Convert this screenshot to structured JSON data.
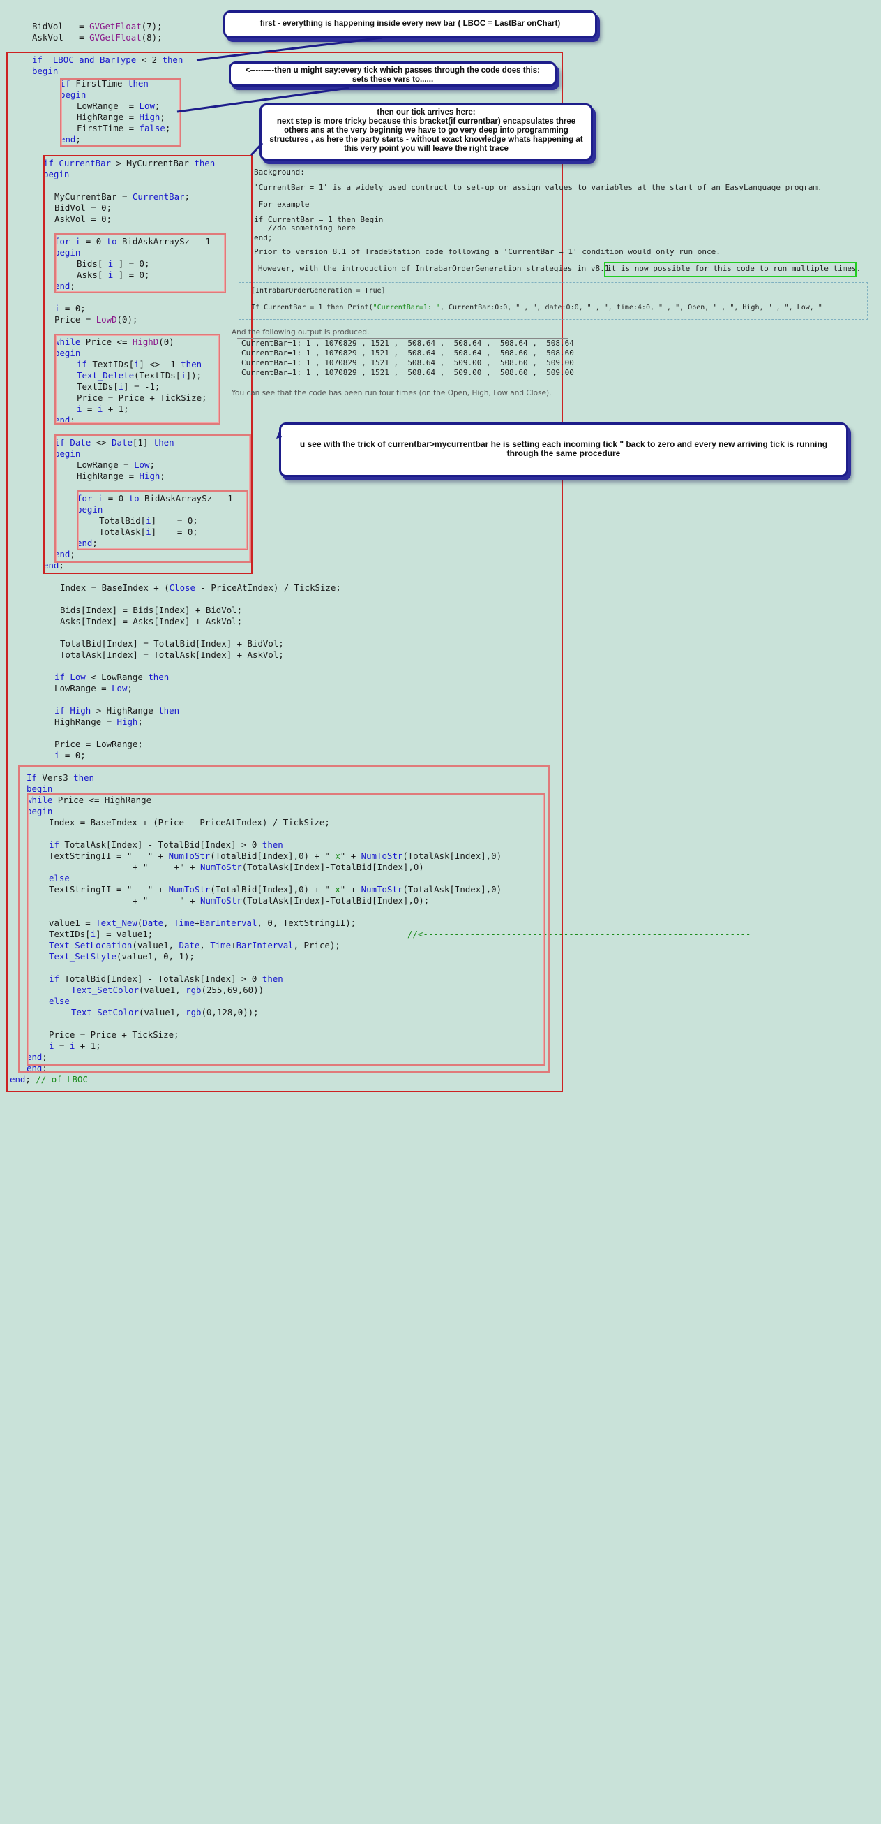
{
  "code_lines": [
    {
      "id": "l1",
      "parts": [
        [
          "",
          "BidVol   = "
        ],
        [
          "pu",
          "GVGetFloat"
        ],
        [
          "",
          "(7);"
        ]
      ]
    },
    {
      "id": "l2",
      "parts": [
        [
          "",
          "AskVol   = "
        ],
        [
          "pu",
          "GVGetFloat"
        ],
        [
          "",
          "(8);"
        ]
      ]
    },
    {
      "id": "l3",
      "parts": [
        [
          "kw",
          "if  LBOC and BarType"
        ],
        [
          "",
          " < 2 "
        ],
        [
          "kw",
          "then"
        ]
      ]
    },
    {
      "id": "l4",
      "parts": [
        [
          "kw",
          "begin"
        ]
      ]
    },
    {
      "id": "l5",
      "parts": [
        [
          "kw",
          "if"
        ],
        [
          "",
          " FirstTime "
        ],
        [
          "kw",
          "then"
        ]
      ]
    },
    {
      "id": "l6",
      "parts": [
        [
          "kw",
          "begin"
        ]
      ]
    },
    {
      "id": "l7",
      "parts": [
        [
          "",
          "LowRange  = "
        ],
        [
          "kw",
          "Low"
        ],
        [
          "",
          ";"
        ]
      ]
    },
    {
      "id": "l8",
      "parts": [
        [
          "",
          "HighRange = "
        ],
        [
          "kw",
          "High"
        ],
        [
          "",
          ";"
        ]
      ]
    },
    {
      "id": "l9",
      "parts": [
        [
          "",
          "FirstTime = "
        ],
        [
          "kw",
          "false"
        ],
        [
          "",
          ";"
        ]
      ]
    },
    {
      "id": "l10",
      "parts": [
        [
          "kw",
          "end"
        ],
        [
          "",
          ";"
        ]
      ]
    },
    {
      "id": "l11",
      "parts": [
        [
          "kw",
          "if"
        ],
        [
          "",
          " "
        ],
        [
          "kw",
          "CurrentBar"
        ],
        [
          "",
          " > MyCurrentBar "
        ],
        [
          "kw",
          "then"
        ]
      ]
    },
    {
      "id": "l12",
      "parts": [
        [
          "kw",
          "begin"
        ]
      ]
    },
    {
      "id": "l13",
      "parts": [
        [
          "",
          "MyCurrentBar = "
        ],
        [
          "kw",
          "CurrentBar"
        ],
        [
          "",
          ";"
        ]
      ]
    },
    {
      "id": "l14",
      "parts": [
        [
          "",
          "BidVol = 0;"
        ]
      ]
    },
    {
      "id": "l15",
      "parts": [
        [
          "",
          "AskVol = 0;"
        ]
      ]
    },
    {
      "id": "l16",
      "parts": [
        [
          "kw",
          "for"
        ],
        [
          "",
          " "
        ],
        [
          "kw",
          "i"
        ],
        [
          "",
          " = 0 "
        ],
        [
          "kw",
          "to"
        ],
        [
          "",
          " BidAskArraySz - 1"
        ]
      ]
    },
    {
      "id": "l17",
      "parts": [
        [
          "kw",
          "begin"
        ]
      ]
    },
    {
      "id": "l18",
      "parts": [
        [
          "",
          "Bids[ "
        ],
        [
          "kw",
          "i"
        ],
        [
          "",
          " ] = 0;"
        ]
      ]
    },
    {
      "id": "l19",
      "parts": [
        [
          "",
          "Asks[ "
        ],
        [
          "kw",
          "i"
        ],
        [
          "",
          " ] = 0;"
        ]
      ]
    },
    {
      "id": "l20",
      "parts": [
        [
          "kw",
          "end"
        ],
        [
          "",
          ";"
        ]
      ]
    },
    {
      "id": "l21",
      "parts": [
        [
          "kw",
          "i"
        ],
        [
          "",
          " = 0;"
        ]
      ]
    },
    {
      "id": "l22",
      "parts": [
        [
          "",
          "Price = "
        ],
        [
          "pu",
          "LowD"
        ],
        [
          "",
          "(0);"
        ]
      ]
    },
    {
      "id": "l23",
      "parts": [
        [
          "kw",
          "while"
        ],
        [
          "",
          " Price <= "
        ],
        [
          "pu",
          "HighD"
        ],
        [
          "",
          "(0)"
        ]
      ]
    },
    {
      "id": "l24",
      "parts": [
        [
          "kw",
          "begin"
        ]
      ]
    },
    {
      "id": "l25",
      "parts": [
        [
          "kw",
          "if"
        ],
        [
          "",
          " TextIDs["
        ],
        [
          "kw",
          "i"
        ],
        [
          "",
          "] <> -1 "
        ],
        [
          "kw",
          "then"
        ]
      ]
    },
    {
      "id": "l26",
      "parts": [
        [
          "fn",
          "Text_Delete"
        ],
        [
          "",
          "(TextIDs["
        ],
        [
          "kw",
          "i"
        ],
        [
          "",
          "]);"
        ]
      ]
    },
    {
      "id": "l27",
      "parts": [
        [
          "",
          "TextIDs["
        ],
        [
          "kw",
          "i"
        ],
        [
          "",
          "] = -1;"
        ]
      ]
    },
    {
      "id": "l28",
      "parts": [
        [
          "",
          "Price = Price + TickSize;"
        ]
      ]
    },
    {
      "id": "l29",
      "parts": [
        [
          "kw",
          "i"
        ],
        [
          "",
          " = "
        ],
        [
          "kw",
          "i"
        ],
        [
          "",
          " + 1;"
        ]
      ]
    },
    {
      "id": "l30",
      "parts": [
        [
          "kw",
          "end"
        ],
        [
          "",
          ";"
        ]
      ]
    },
    {
      "id": "l31",
      "parts": [
        [
          "kw",
          "if"
        ],
        [
          "",
          " "
        ],
        [
          "kw",
          "Date"
        ],
        [
          "",
          " <> "
        ],
        [
          "kw",
          "Date"
        ],
        [
          "",
          "[1] "
        ],
        [
          "kw",
          "then"
        ]
      ]
    },
    {
      "id": "l32",
      "parts": [
        [
          "kw",
          "begin"
        ]
      ]
    },
    {
      "id": "l33",
      "parts": [
        [
          "",
          "LowRange = "
        ],
        [
          "kw",
          "Low"
        ],
        [
          "",
          ";"
        ]
      ]
    },
    {
      "id": "l34",
      "parts": [
        [
          "",
          "HighRange = "
        ],
        [
          "kw",
          "High"
        ],
        [
          "",
          ";"
        ]
      ]
    },
    {
      "id": "l35",
      "parts": [
        [
          "kw",
          "for"
        ],
        [
          "",
          " "
        ],
        [
          "kw",
          "i"
        ],
        [
          "",
          " = 0 "
        ],
        [
          "kw",
          "to"
        ],
        [
          "",
          " BidAskArraySz - 1"
        ]
      ]
    },
    {
      "id": "l36",
      "parts": [
        [
          "kw",
          "begin"
        ]
      ]
    },
    {
      "id": "l37",
      "parts": [
        [
          "",
          "TotalBid["
        ],
        [
          "kw",
          "i"
        ],
        [
          "",
          "]    = 0;"
        ]
      ]
    },
    {
      "id": "l38",
      "parts": [
        [
          "",
          "TotalAsk["
        ],
        [
          "kw",
          "i"
        ],
        [
          "",
          "]    = 0;"
        ]
      ]
    },
    {
      "id": "l39",
      "parts": [
        [
          "kw",
          "end"
        ],
        [
          "",
          ";"
        ]
      ]
    },
    {
      "id": "l40",
      "parts": [
        [
          "kw",
          "end"
        ],
        [
          "",
          ";"
        ]
      ]
    },
    {
      "id": "l41",
      "parts": [
        [
          "kw",
          "end"
        ],
        [
          "",
          ";"
        ]
      ]
    },
    {
      "id": "l42",
      "parts": [
        [
          "",
          "Index = BaseIndex + ("
        ],
        [
          "kw",
          "Close"
        ],
        [
          "",
          " - PriceAtIndex) / TickSize;"
        ]
      ]
    },
    {
      "id": "l43",
      "parts": [
        [
          "",
          "Bids[Index] = Bids[Index] + BidVol;"
        ]
      ]
    },
    {
      "id": "l44",
      "parts": [
        [
          "",
          "Asks[Index] = Asks[Index] + AskVol;"
        ]
      ]
    },
    {
      "id": "l45",
      "parts": [
        [
          "",
          "TotalBid[Index] = TotalBid[Index] + BidVol;"
        ]
      ]
    },
    {
      "id": "l46",
      "parts": [
        [
          "",
          "TotalAsk[Index] = TotalAsk[Index] + AskVol;"
        ]
      ]
    },
    {
      "id": "l47",
      "parts": [
        [
          "kw",
          "if"
        ],
        [
          "",
          " "
        ],
        [
          "kw",
          "Low"
        ],
        [
          "",
          " < LowRange "
        ],
        [
          "kw",
          "then"
        ]
      ]
    },
    {
      "id": "l48",
      "parts": [
        [
          "",
          "LowRange = "
        ],
        [
          "kw",
          "Low"
        ],
        [
          "",
          ";"
        ]
      ]
    },
    {
      "id": "l49",
      "parts": [
        [
          "kw",
          "if"
        ],
        [
          "",
          " "
        ],
        [
          "kw",
          "High"
        ],
        [
          "",
          " > HighRange "
        ],
        [
          "kw",
          "then"
        ]
      ]
    },
    {
      "id": "l50",
      "parts": [
        [
          "",
          "HighRange = "
        ],
        [
          "kw",
          "High"
        ],
        [
          "",
          ";"
        ]
      ]
    },
    {
      "id": "l51",
      "parts": [
        [
          "",
          "Price = LowRange;"
        ]
      ]
    },
    {
      "id": "l52",
      "parts": [
        [
          "kw",
          "i"
        ],
        [
          "",
          " = 0;"
        ]
      ]
    },
    {
      "id": "l53",
      "parts": [
        [
          "kw",
          "If"
        ],
        [
          "",
          " Vers3 "
        ],
        [
          "kw",
          "then"
        ]
      ]
    },
    {
      "id": "l54",
      "parts": [
        [
          "kw",
          "begin"
        ]
      ]
    },
    {
      "id": "l55",
      "parts": [
        [
          "kw",
          "while"
        ],
        [
          "",
          " Price <= HighRange"
        ]
      ]
    },
    {
      "id": "l56",
      "parts": [
        [
          "kw",
          "begin"
        ]
      ]
    },
    {
      "id": "l57",
      "parts": [
        [
          "",
          "Index = BaseIndex + (Price - PriceAtIndex) / TickSize;"
        ]
      ]
    },
    {
      "id": "l58",
      "parts": [
        [
          "kw",
          "if"
        ],
        [
          "",
          " TotalAsk[Index] - TotalBid[Index] > 0 "
        ],
        [
          "kw",
          "then"
        ]
      ]
    },
    {
      "id": "l59",
      "parts": [
        [
          "",
          "TextStringII = \"   \" + "
        ],
        [
          "fn",
          "NumToStr"
        ],
        [
          "",
          "(TotalBid[Index],0) + \" "
        ],
        [
          "gr",
          "x"
        ],
        [
          "",
          "\" + "
        ],
        [
          "fn",
          "NumToStr"
        ],
        [
          "",
          "(TotalAsk[Index],0)"
        ]
      ]
    },
    {
      "id": "l60",
      "parts": [
        [
          "",
          "+ \"     +\" + "
        ],
        [
          "fn",
          "NumToStr"
        ],
        [
          "",
          "(TotalAsk[Index]-TotalBid[Index],0)"
        ]
      ]
    },
    {
      "id": "l61",
      "parts": [
        [
          "kw",
          "else"
        ]
      ]
    },
    {
      "id": "l62",
      "parts": [
        [
          "",
          "TextStringII = \"   \" + "
        ],
        [
          "fn",
          "NumToStr"
        ],
        [
          "",
          "(TotalBid[Index],0) + \" "
        ],
        [
          "gr",
          "x"
        ],
        [
          "",
          "\" + "
        ],
        [
          "fn",
          "NumToStr"
        ],
        [
          "",
          "(TotalAsk[Index],0)"
        ]
      ]
    },
    {
      "id": "l63",
      "parts": [
        [
          "",
          "+ \"      \" + "
        ],
        [
          "fn",
          "NumToStr"
        ],
        [
          "",
          "(TotalAsk[Index]-TotalBid[Index],0);"
        ]
      ]
    },
    {
      "id": "l64",
      "parts": [
        [
          "",
          "value1 = "
        ],
        [
          "fn",
          "Text_New"
        ],
        [
          "",
          "("
        ],
        [
          "kw",
          "Date"
        ],
        [
          "",
          ", "
        ],
        [
          "kw",
          "Time"
        ],
        [
          "",
          "+"
        ],
        [
          "kw",
          "BarInterval"
        ],
        [
          "",
          ", 0, TextStringII);"
        ]
      ]
    },
    {
      "id": "l65",
      "parts": [
        [
          "",
          "TextIDs["
        ],
        [
          "kw",
          "i"
        ],
        [
          "",
          "] = value1;"
        ]
      ]
    },
    {
      "id": "l65c",
      "parts": [
        [
          "gr",
          "//<---------------------------------------------------------------"
        ]
      ]
    },
    {
      "id": "l66",
      "parts": [
        [
          "fn",
          "Text_SetLocation"
        ],
        [
          "",
          "(value1, "
        ],
        [
          "kw",
          "Date"
        ],
        [
          "",
          ", "
        ],
        [
          "kw",
          "Time"
        ],
        [
          "",
          "+"
        ],
        [
          "kw",
          "BarInterval"
        ],
        [
          "",
          ", Price);"
        ]
      ]
    },
    {
      "id": "l67",
      "parts": [
        [
          "fn",
          "Text_SetStyle"
        ],
        [
          "",
          "(value1, 0, 1);"
        ]
      ]
    },
    {
      "id": "l68",
      "parts": [
        [
          "kw",
          "if"
        ],
        [
          "",
          " TotalBid[Index] - TotalAsk[Index] > 0 "
        ],
        [
          "kw",
          "then"
        ]
      ]
    },
    {
      "id": "l69",
      "parts": [
        [
          "fn",
          "Text_SetColor"
        ],
        [
          "",
          "(value1, "
        ],
        [
          "fn",
          "rgb"
        ],
        [
          "",
          "(255,69,60))"
        ]
      ]
    },
    {
      "id": "l70",
      "parts": [
        [
          "kw",
          "else"
        ]
      ]
    },
    {
      "id": "l71",
      "parts": [
        [
          "fn",
          "Text_SetColor"
        ],
        [
          "",
          "(value1, "
        ],
        [
          "fn",
          "rgb"
        ],
        [
          "",
          "(0,128,0));"
        ]
      ]
    },
    {
      "id": "l72",
      "parts": [
        [
          "",
          "Price = Price + TickSize;"
        ]
      ]
    },
    {
      "id": "l73",
      "parts": [
        [
          "kw",
          "i"
        ],
        [
          "",
          " = "
        ],
        [
          "kw",
          "i"
        ],
        [
          "",
          " + 1;"
        ]
      ]
    },
    {
      "id": "l74",
      "parts": [
        [
          "kw",
          "end"
        ],
        [
          "",
          ";"
        ]
      ]
    },
    {
      "id": "l75",
      "parts": [
        [
          "kw",
          "end"
        ],
        [
          "",
          ";"
        ]
      ]
    },
    {
      "id": "l76",
      "parts": [
        [
          "kw",
          "end"
        ],
        [
          "",
          "; "
        ],
        [
          "gr",
          "// of LBOC"
        ]
      ]
    }
  ],
  "callouts": {
    "c1": "first - everything is happening inside every new bar ( LBOC = LastBar onChart)",
    "c2": "<---------then u might say:every tick which passes through the code does this: sets these vars to......",
    "c3": "then our tick arrives here:\nnext step is more tricky because this bracket(if currentbar) encapsulates three others ans at the very beginnig we have to go very deep into programming structures , as here the party starts - without exact knowledge whats happening at this very point you will leave the right trace",
    "c4": "u see with the trick of currentbar>mycurrentbar he is setting each incoming tick \" back to zero and every new arriving tick is running through the same procedure"
  },
  "reference": {
    "background": "Background:",
    "intro": "'CurrentBar = 1' is a widely used contruct to set-up or assign values to variables at the start of an EasyLanguage program.",
    "for_example": " For example",
    "ex1": "if CurrentBar = 1 then Begin",
    "ex2": "   //do something here",
    "ex3": "end;",
    "prior": "Prior to version 8.1 of TradeStation code following a 'CurrentBar = 1' condition would only run once.",
    "however": "However, with the introduction of IntrabarOrderGeneration strategies in v8.1 ",
    "highlight": "it is now possible for this code to run multiple times.",
    "iog": "[IntrabarOrderGeneration = True]",
    "print_prefix": "If CurrentBar = 1 then Print(",
    "print_string": "\"CurrentBar=1: \"",
    "print_suffix": ", CurrentBar:0:0, \" , \", date:0:0, \" , \", time:4:0, \" , \", Open, \" , \", High, \" , \", Low, \"",
    "produced": "And the following output is produced.",
    "output": [
      "CurrentBar=1: 1 , 1070829 , 1521 ,  508.64 ,  508.64 ,  508.64 ,  508.64",
      "CurrentBar=1: 1 , 1070829 , 1521 ,  508.64 ,  508.64 ,  508.60 ,  508.60",
      "CurrentBar=1: 1 , 1070829 , 1521 ,  508.64 ,  509.00 ,  508.60 ,  509.00",
      "CurrentBar=1: 1 , 1070829 , 1521 ,  508.64 ,  509.00 ,  508.60 ,  509.00"
    ],
    "conclusion": "You can see that the code has been run four times (on the Open, High, Low and Close)."
  }
}
